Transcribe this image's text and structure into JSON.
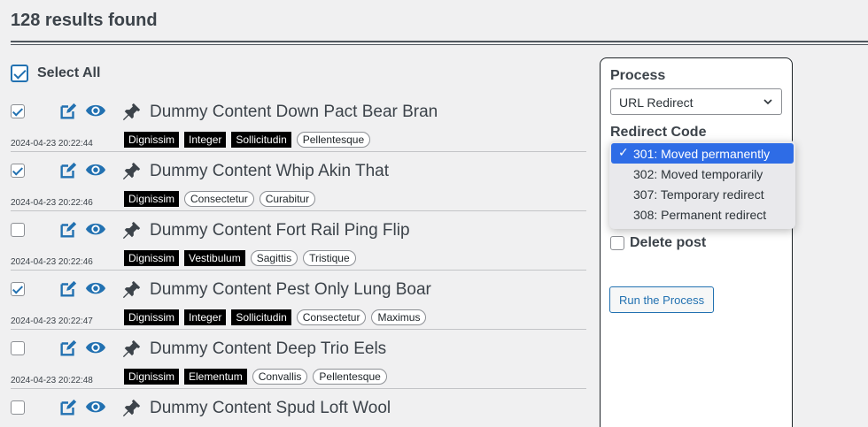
{
  "results_title": "128 results found",
  "select_all": {
    "label": "Select All",
    "checked": true
  },
  "colors": {
    "accent": "#2271b1",
    "tag_dark": "#000000",
    "selected_option": "#2e6ce6"
  },
  "posts": [
    {
      "title": "Dummy Content Down Pact Bear Bran",
      "date": "2024-04-23 20:22:44",
      "checked": true,
      "tags": [
        {
          "name": "Dignissim",
          "style": "dark"
        },
        {
          "name": "Integer",
          "style": "dark"
        },
        {
          "name": "Sollicitudin",
          "style": "dark"
        },
        {
          "name": "Pellentesque",
          "style": "light"
        }
      ]
    },
    {
      "title": "Dummy Content Whip Akin That",
      "date": "2024-04-23 20:22:46",
      "checked": true,
      "tags": [
        {
          "name": "Dignissim",
          "style": "dark"
        },
        {
          "name": "Consectetur",
          "style": "light"
        },
        {
          "name": "Curabitur",
          "style": "light"
        }
      ]
    },
    {
      "title": "Dummy Content Fort Rail Ping Flip",
      "date": "2024-04-23 20:22:46",
      "checked": false,
      "tags": [
        {
          "name": "Dignissim",
          "style": "dark"
        },
        {
          "name": "Vestibulum",
          "style": "dark"
        },
        {
          "name": "Sagittis",
          "style": "light"
        },
        {
          "name": "Tristique",
          "style": "light"
        }
      ]
    },
    {
      "title": "Dummy Content Pest Only Lung Boar",
      "date": "2024-04-23 20:22:47",
      "checked": true,
      "tags": [
        {
          "name": "Dignissim",
          "style": "dark"
        },
        {
          "name": "Integer",
          "style": "dark"
        },
        {
          "name": "Sollicitudin",
          "style": "dark"
        },
        {
          "name": "Consectetur",
          "style": "light"
        },
        {
          "name": "Maximus",
          "style": "light"
        }
      ]
    },
    {
      "title": "Dummy Content Deep Trio Eels",
      "date": "2024-04-23 20:22:48",
      "checked": false,
      "tags": [
        {
          "name": "Dignissim",
          "style": "dark"
        },
        {
          "name": "Elementum",
          "style": "dark"
        },
        {
          "name": "Convallis",
          "style": "light"
        },
        {
          "name": "Pellentesque",
          "style": "light"
        }
      ]
    },
    {
      "title": "Dummy Content Spud Loft Wool",
      "date": "",
      "checked": false,
      "tags": []
    }
  ],
  "post_icons": {
    "edit": "edit-icon",
    "view": "eye-icon",
    "pin": "pin-icon"
  },
  "panel": {
    "process_label": "Process",
    "process_value": "URL Redirect",
    "redirect_label": "Redirect Code",
    "redirect_options": [
      {
        "label": "301: Moved permanently",
        "selected": true
      },
      {
        "label": "302: Moved temporarily",
        "selected": false
      },
      {
        "label": "307: Temporary redirect",
        "selected": false
      },
      {
        "label": "308: Permanent redirect",
        "selected": false
      }
    ],
    "delete_label": "Delete post",
    "delete_checked": false,
    "run_button": "Run the Process"
  }
}
